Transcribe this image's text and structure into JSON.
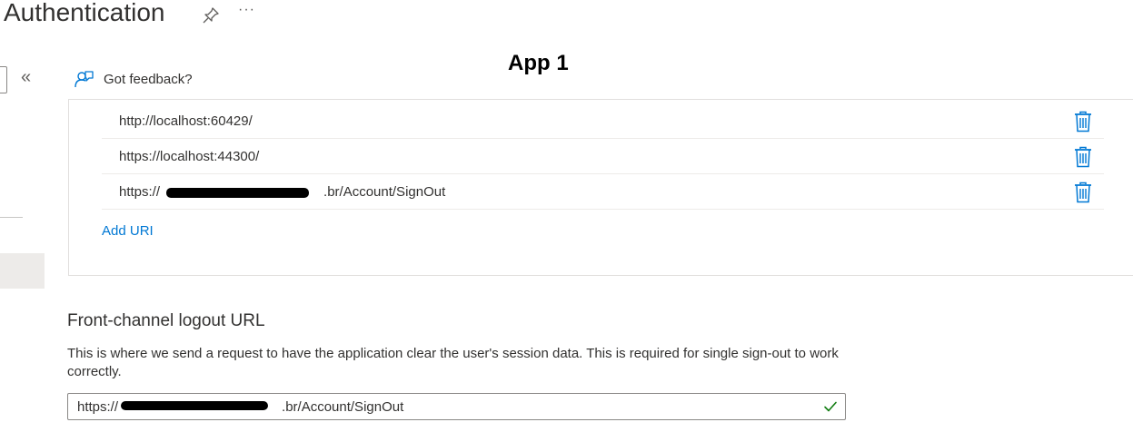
{
  "header": {
    "title": "Authentication",
    "more_label": "···"
  },
  "annotation": "App 1",
  "sidebar": {
    "collapse_label": "«"
  },
  "toolbar": {
    "feedback_label": "Got feedback?"
  },
  "redirect_uris": {
    "items": [
      {
        "url": "http://localhost:60429/"
      },
      {
        "url": "https://localhost:44300/"
      },
      {
        "url": "https://            .br/Account/SignOut"
      }
    ],
    "add_label": "Add URI"
  },
  "front_channel": {
    "heading": "Front-channel logout URL",
    "description": "This is where we send a request to have the application clear the user's session data. This is required for single sign-out to work correctly.",
    "value": "https://            .br/Account/SignOut"
  },
  "colors": {
    "accent": "#0078d4",
    "valid": "#107c10"
  },
  "icons": {
    "pin": "pin-icon",
    "more": "more-icon",
    "feedback": "feedback-icon",
    "trash": "trash-icon",
    "check": "checkmark-icon",
    "collapse": "collapse-icon"
  }
}
